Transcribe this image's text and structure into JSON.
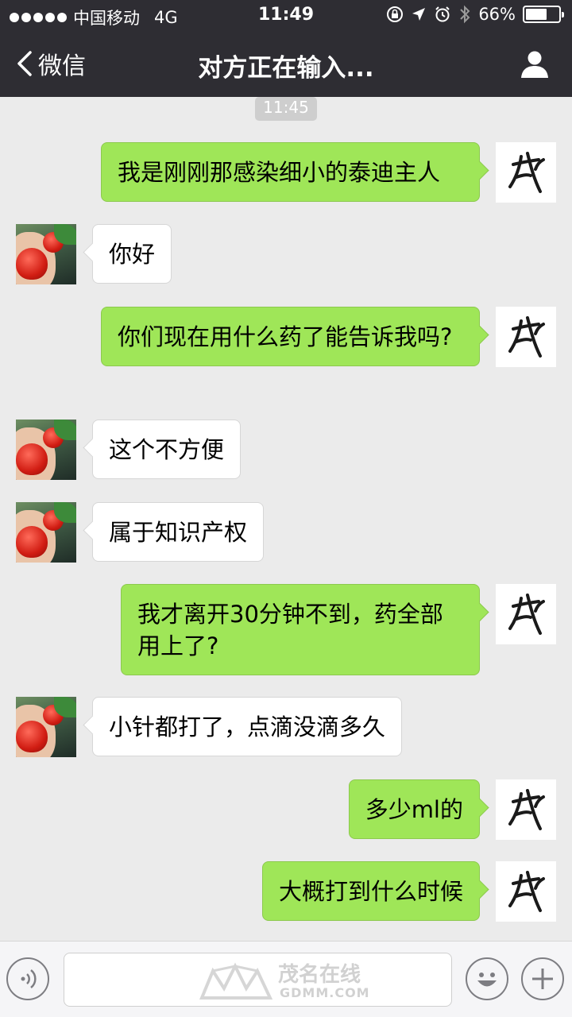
{
  "status_bar": {
    "carrier": "中国移动",
    "network": "4G",
    "time": "11:49",
    "battery_percent": "66%",
    "battery_level": 0.66
  },
  "nav": {
    "back_label": "微信",
    "title": "对方正在输入..."
  },
  "chat": {
    "timestamp": "11:45",
    "messages": [
      {
        "side": "out",
        "text": "我是刚刚那感染细小的泰迪主人"
      },
      {
        "side": "in",
        "text": "你好"
      },
      {
        "side": "out",
        "text": "你们现在用什么药了能告诉我吗?"
      },
      {
        "side": "in",
        "text": "这个不方便"
      },
      {
        "side": "in",
        "text": "属于知识产权"
      },
      {
        "side": "out",
        "text": "我才离开30分钟不到，药全部用上了?"
      },
      {
        "side": "in",
        "text": "小针都打了，点滴没滴多久"
      },
      {
        "side": "out",
        "text": "多少ml的"
      },
      {
        "side": "out",
        "text": "大概打到什么时候"
      }
    ]
  },
  "watermark": {
    "title": "茂名在线",
    "subtitle": "GDMM.COM"
  },
  "colors": {
    "nav_bg": "#2e2d33",
    "chat_bg": "#ebebeb",
    "outgoing_bubble": "#9fe658",
    "incoming_bubble": "#ffffff"
  }
}
